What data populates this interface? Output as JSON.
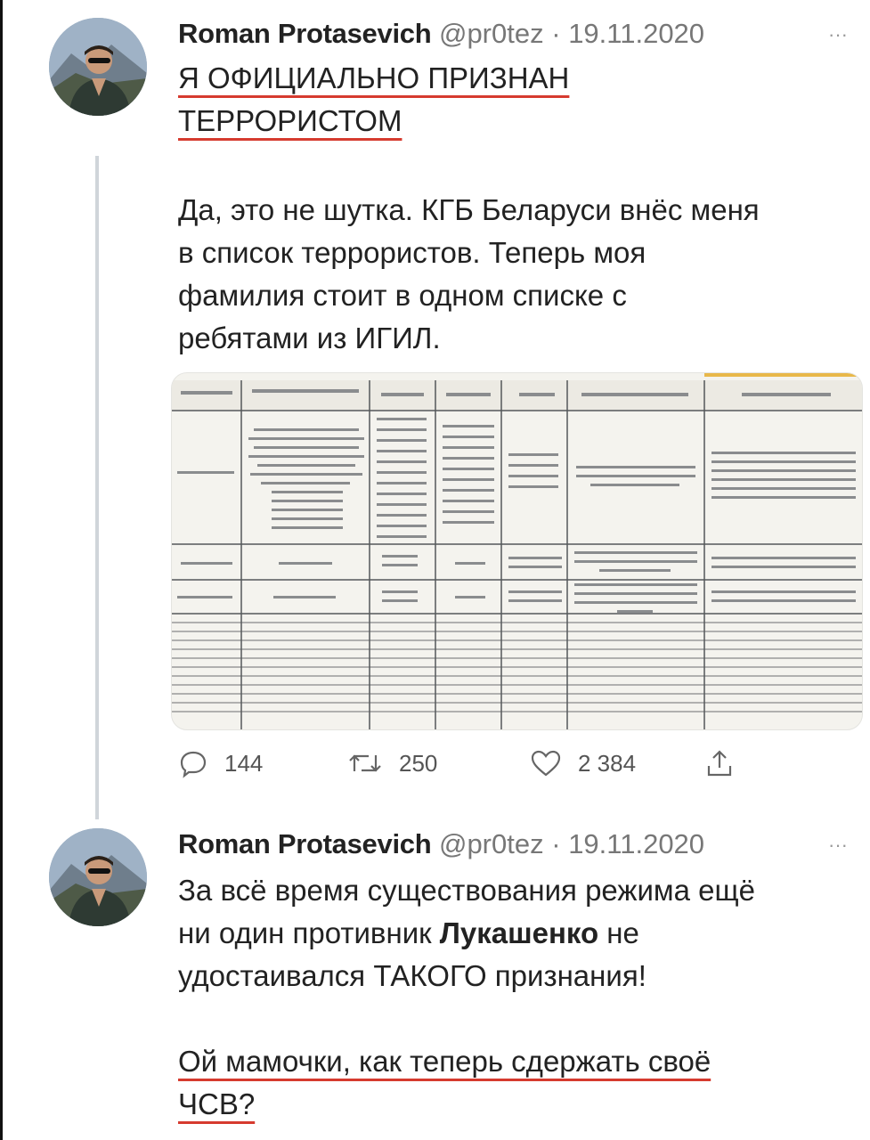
{
  "tweets": [
    {
      "author": "Roman Protasevich",
      "handle": "@pr0tez",
      "separator": "·",
      "date": "19.11.2020",
      "more": "···",
      "headline_line1": "Я ОФИЦИАЛЬНО ПРИЗНАН",
      "headline_line2": "ТЕРРОРИСТОМ",
      "body": [
        "Да, это не шутка. КГБ Беларуси внёс меня",
        "в список террористов. Теперь моя",
        "фамилия стоит в одном списке с",
        "ребятами из ИГИЛ."
      ],
      "stats": {
        "replies": "144",
        "retweets": "250",
        "likes": "2 384"
      }
    },
    {
      "author": "Roman Protasevich",
      "handle": "@pr0tez",
      "separator": "·",
      "date": "19.11.2020",
      "more": "···",
      "line1": "За всё время существования режима ещё",
      "line2_pre": "ни один противник ",
      "line2_bold": "Лукашенко",
      "line2_post": " не",
      "line3": "удостаивался ТАКОГО признания!",
      "closing_line1": "Ой мамочки, как теперь сдержать своё",
      "closing_line2": "ЧСВ?"
    }
  ],
  "colors": {
    "underline": "#d63b2f",
    "muted": "#777777",
    "thread": "#d0d5da",
    "sheet_accent": "#e8b84a"
  },
  "icons": [
    "reply-icon",
    "retweet-icon",
    "like-icon",
    "share-icon",
    "more-icon"
  ]
}
